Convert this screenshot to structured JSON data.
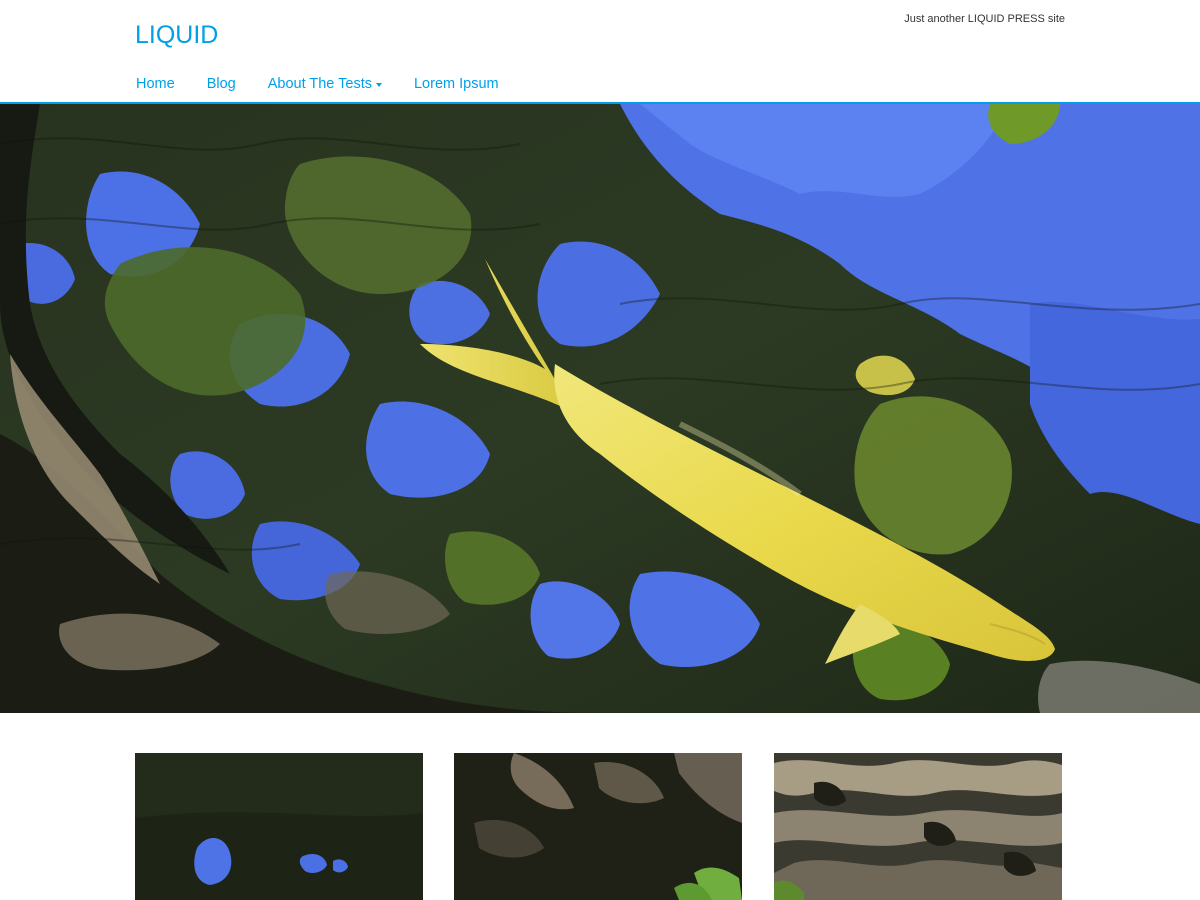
{
  "site": {
    "logo": "LIQUID",
    "tagline": "Just another LIQUID PRESS site"
  },
  "nav": {
    "items": [
      {
        "label": "Home"
      },
      {
        "label": "Blog"
      },
      {
        "label": "About The Tests",
        "has_dropdown": true
      },
      {
        "label": "Lorem Ipsum"
      }
    ]
  },
  "colors": {
    "accent": "#00a0e9",
    "tagline_text": "#333333",
    "background": "#ffffff"
  },
  "hero": {
    "image": "koi-fish-pond-photo"
  },
  "cards": [
    {
      "image": "dark-water-with-blue-reflection-photo"
    },
    {
      "image": "rippled-water-with-leaves-photo"
    },
    {
      "image": "light-rippled-water-photo"
    }
  ]
}
